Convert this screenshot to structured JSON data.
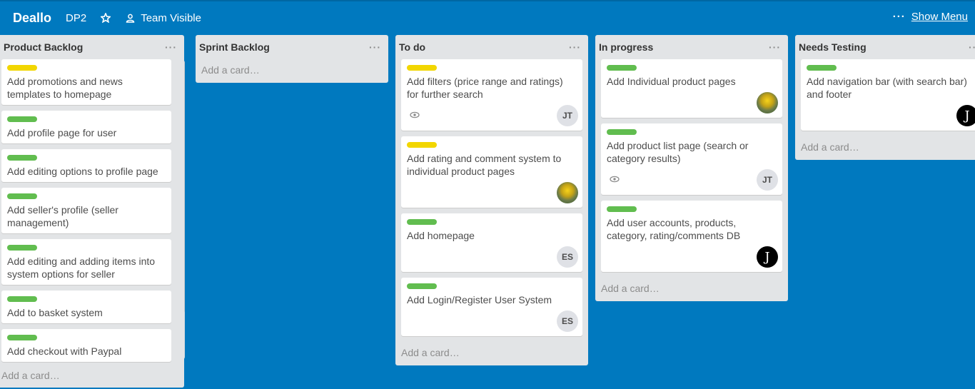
{
  "header": {
    "board_name": "Deallo",
    "board_sub": "DP2",
    "visibility": "Team Visible",
    "show_menu": "Show Menu",
    "menu_dots": "···"
  },
  "lists": [
    {
      "title": "Product Backlog",
      "menu": "···",
      "add_card": "Add a card…",
      "cards": [
        {
          "label": "yellow",
          "title": "Add promotions and news templates to homepage"
        },
        {
          "label": "green",
          "title": "Add profile page for user"
        },
        {
          "label": "green",
          "title": "Add editing options to profile page"
        },
        {
          "label": "green",
          "title": "Add seller's profile (seller management)"
        },
        {
          "label": "green",
          "title": "Add editing and adding items into system options for seller"
        },
        {
          "label": "green",
          "title": "Add to basket system"
        },
        {
          "label": "green",
          "title": "Add checkout with Paypal"
        }
      ]
    },
    {
      "title": "Sprint Backlog",
      "menu": "···",
      "add_card": "Add a card…",
      "cards": []
    },
    {
      "title": "To do",
      "menu": "···",
      "add_card": "Add a card…",
      "cards": [
        {
          "label": "yellow",
          "title": "Add filters (price range and ratings) for further search",
          "watch": true,
          "avatar": "JT"
        },
        {
          "label": "yellow",
          "title": "Add rating and comment system to individual product pages",
          "avatar_photo": true
        },
        {
          "label": "green",
          "title": "Add homepage",
          "avatar": "ES"
        },
        {
          "label": "green",
          "title": "Add Login/Register User System",
          "avatar": "ES"
        }
      ]
    },
    {
      "title": "In progress",
      "menu": "···",
      "add_card": "Add a card…",
      "cards": [
        {
          "label": "green",
          "title": "Add Individual product pages",
          "avatar_photo": true
        },
        {
          "label": "green",
          "title": "Add product list page (search or category results)",
          "watch": true,
          "avatar": "JT"
        },
        {
          "label": "green",
          "title": "Add user accounts, products, category, rating/comments DB",
          "avatar_dark": "J"
        }
      ]
    },
    {
      "title": "Needs Testing",
      "menu": "···",
      "add_card": "Add a card…",
      "cards": [
        {
          "label": "green",
          "title": "Add navigation bar (with search bar) and footer",
          "avatar_dark": "J"
        }
      ]
    }
  ],
  "colors": {
    "board_bg": "#0079bf",
    "list_bg": "#e2e4e6",
    "label_green": "#61bd4f",
    "label_yellow": "#f2d600"
  },
  "icons": {
    "star": "star-icon",
    "team": "team-icon",
    "watch": "eye-icon",
    "list_menu": "more-horizontal-icon"
  }
}
